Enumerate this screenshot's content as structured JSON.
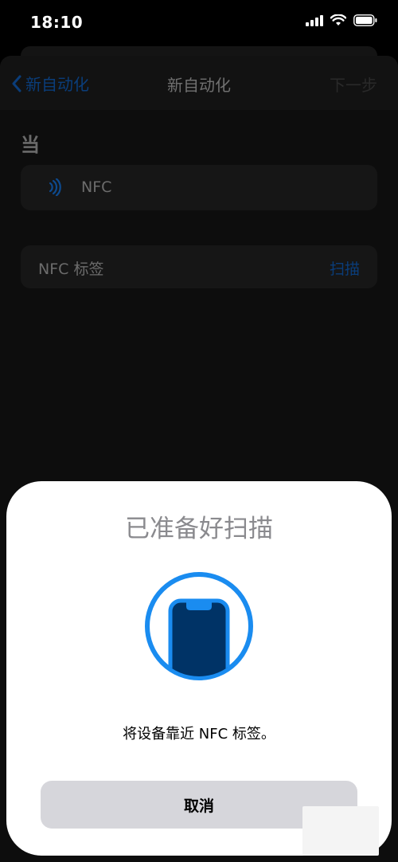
{
  "status_bar": {
    "time": "18:10",
    "icons": [
      "cellular-signal-icon",
      "wifi-icon",
      "battery-icon"
    ]
  },
  "nav": {
    "back_label": "新自动化",
    "title": "新自动化",
    "next_label": "下一步"
  },
  "section": {
    "label": "当"
  },
  "trigger": {
    "icon": "nfc-icon",
    "label": "NFC"
  },
  "tag": {
    "label": "NFC 标签",
    "scan_label": "扫描"
  },
  "modal": {
    "title": "已准备好扫描",
    "graphic": "phone-scan-icon",
    "message": "将设备靠近 NFC 标签。",
    "cancel_label": "取消"
  },
  "colors": {
    "accent_blue": "#1a8cf0",
    "phone_fill": "#003366",
    "modal_bg": "#ffffff",
    "cancel_bg": "#d6d6db"
  }
}
